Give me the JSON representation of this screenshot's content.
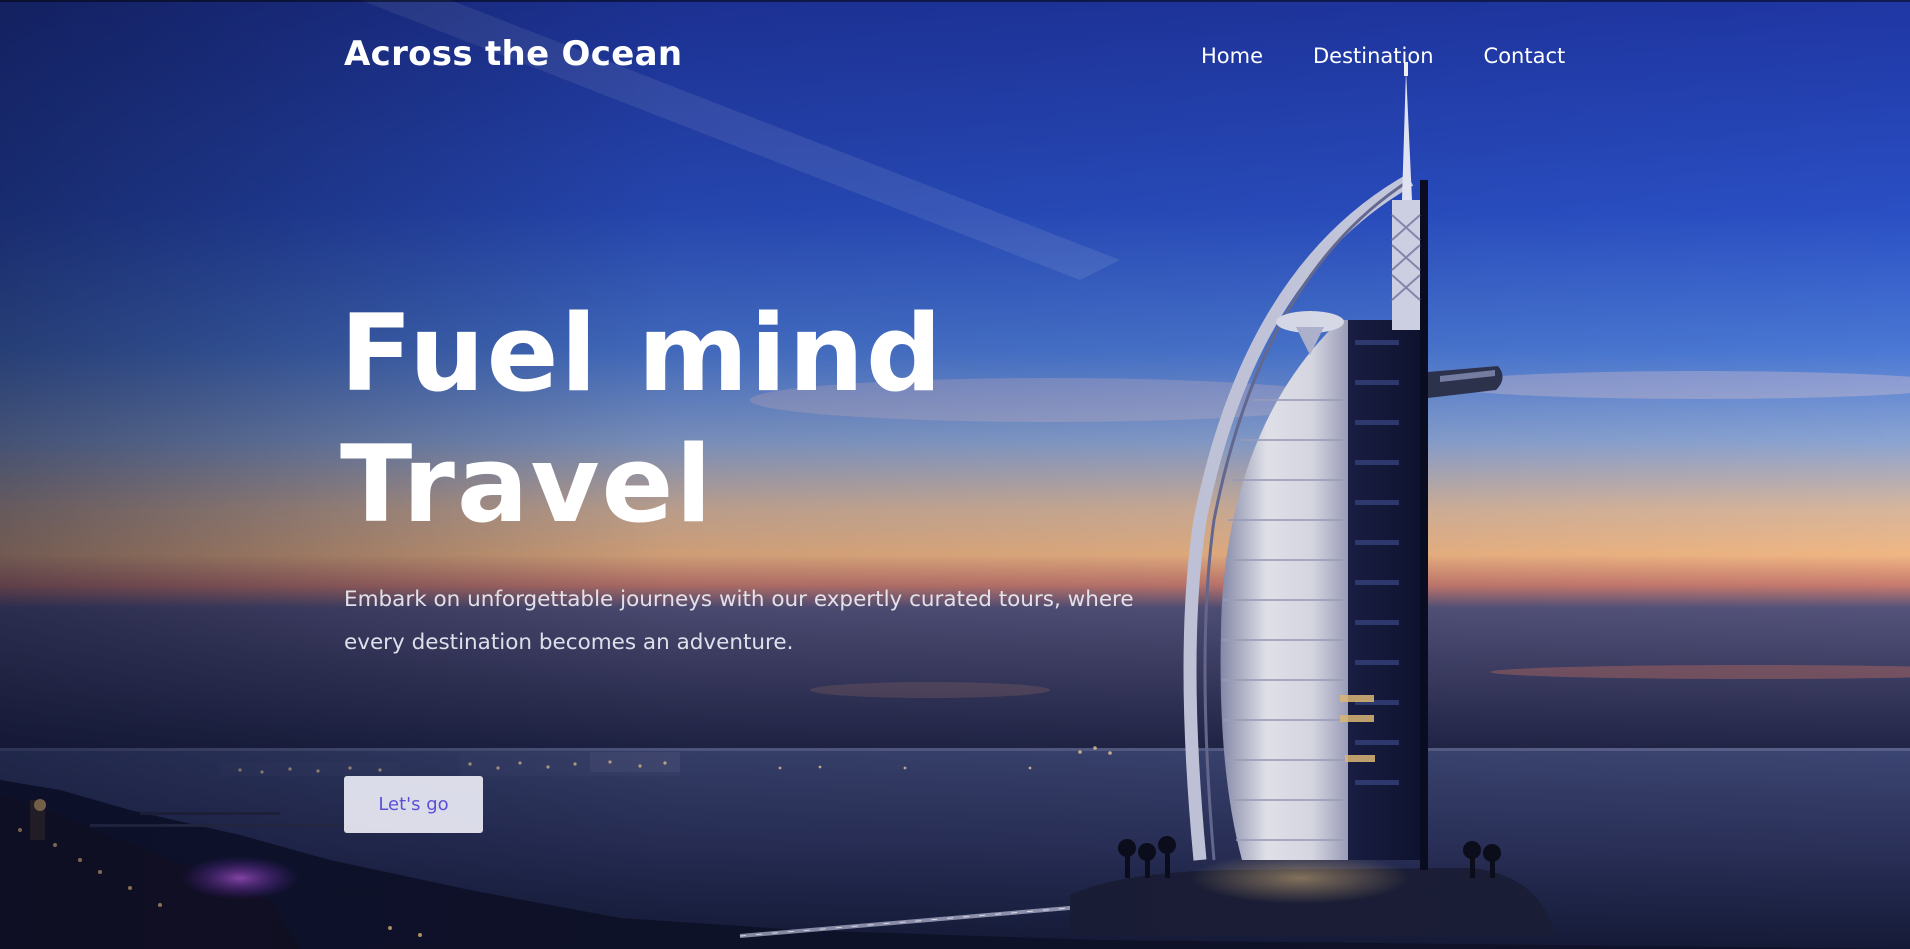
{
  "brand": {
    "name": "Across the Ocean"
  },
  "nav": {
    "items": [
      {
        "label": "Home"
      },
      {
        "label": "Destination"
      },
      {
        "label": "Contact"
      }
    ]
  },
  "hero": {
    "headline_line1": "Fuel mind",
    "headline_line2": "Travel",
    "subtitle": "Embark on unforgettable journeys with our expertly curated tours, where every destination becomes an adventure.",
    "cta_label": "Let's go",
    "background_image": "burj-al-arab-sunset-photo"
  },
  "colors": {
    "text_primary": "#ffffff",
    "cta_background": "#e9eaf4",
    "cta_text": "#5b4fd8",
    "sky_top": "#1e3aa8",
    "horizon_glow": "#f2b98a",
    "sea": "#2c3258"
  }
}
